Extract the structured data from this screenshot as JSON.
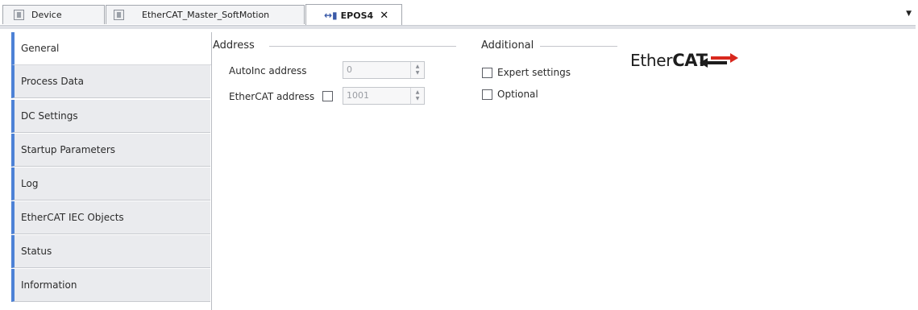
{
  "tabs": [
    {
      "label": "Device"
    },
    {
      "label": "EtherCAT_Master_SoftMotion"
    },
    {
      "label": "EPOS4",
      "active": true
    }
  ],
  "sidebar": {
    "items": [
      {
        "label": "General",
        "active": true
      },
      {
        "label": "Process Data"
      },
      {
        "label": "DC Settings"
      },
      {
        "label": "Startup Parameters"
      },
      {
        "label": "Log"
      },
      {
        "label": "EtherCAT IEC Objects"
      },
      {
        "label": "Status"
      },
      {
        "label": "Information"
      }
    ]
  },
  "address": {
    "title": "Address",
    "autoinc_label": "AutoInc address",
    "autoinc_value": "0",
    "ethercat_label": "EtherCAT address",
    "ethercat_checked": false,
    "ethercat_value": "1001"
  },
  "additional": {
    "title": "Additional",
    "expert_label": "Expert settings",
    "expert_checked": false,
    "optional_label": "Optional",
    "optional_checked": false
  },
  "logo": {
    "text_plain": "Ether",
    "text_bold": "CAT",
    "colors": {
      "red": "#d8281e",
      "black": "#1d1d1d"
    }
  },
  "colors": {
    "accent": "#4d82d6",
    "sidebar_bg": "#eaebee"
  }
}
